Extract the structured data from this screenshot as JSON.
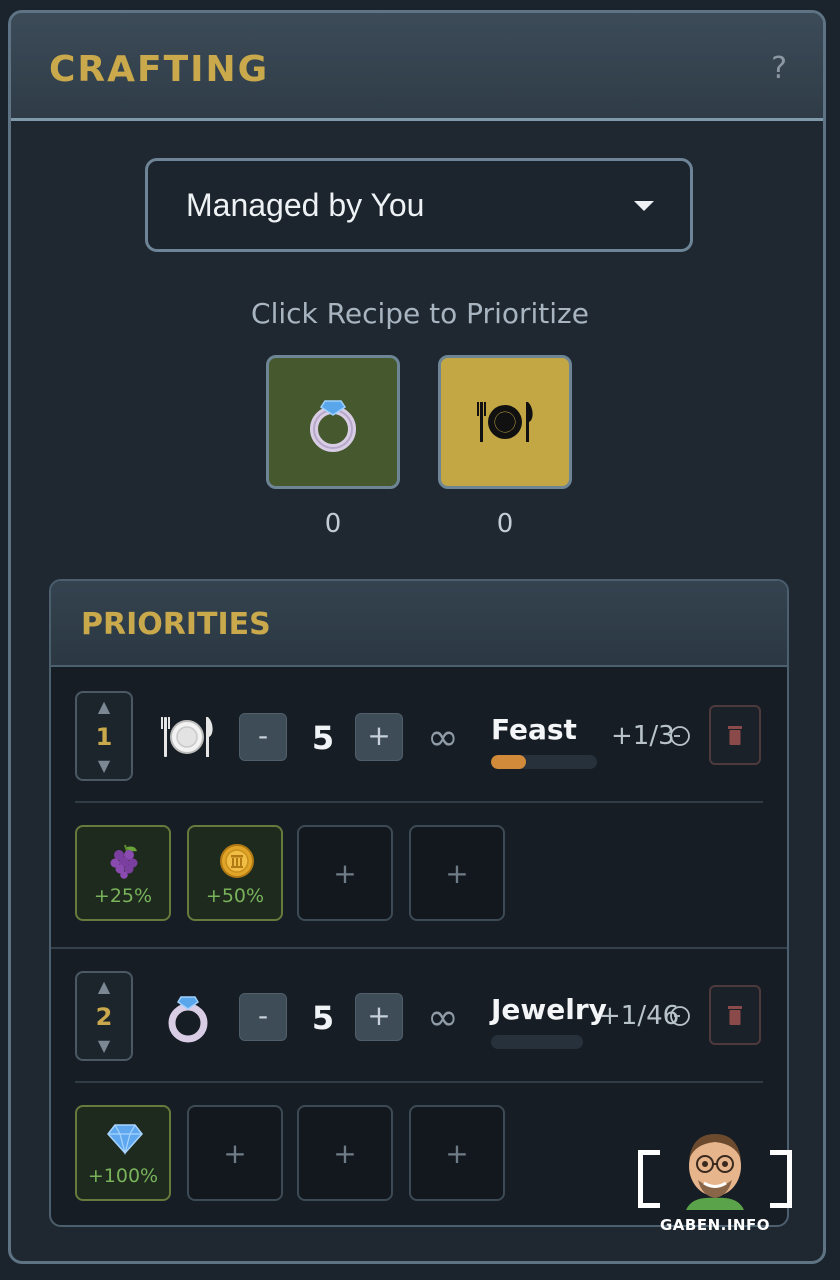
{
  "panel": {
    "title": "CRAFTING",
    "help_label": "?"
  },
  "dropdown": {
    "selected": "Managed by You"
  },
  "hint": "Click Recipe to Prioritize",
  "recipes": [
    {
      "icon": "ring-icon",
      "count": "0",
      "bg": "#46582e"
    },
    {
      "icon": "plate-cutlery-icon",
      "count": "0",
      "bg": "#c3a744"
    }
  ],
  "priorities": {
    "title": "PRIORITIES",
    "rows": [
      {
        "order": "1",
        "icon": "plate-cutlery-icon",
        "minus": "-",
        "qty": "5",
        "plus": "+",
        "limit": "∞",
        "name": "Feast",
        "progress": 0.33,
        "rate": "+1/3",
        "bonuses": [
          {
            "icon": "grapes-icon",
            "value": "+25%"
          },
          {
            "icon": "coin-icon",
            "value": "+50%"
          }
        ],
        "empty_slot": "+"
      },
      {
        "order": "2",
        "icon": "ring-icon",
        "minus": "-",
        "qty": "5",
        "plus": "+",
        "limit": "∞",
        "name": "Jewelry",
        "progress": 0,
        "rate": "+1/46",
        "bonuses": [
          {
            "icon": "gem-icon",
            "value": "+100%"
          }
        ],
        "empty_slot": "+"
      }
    ]
  },
  "watermark": {
    "text": "GABEN.INFO"
  },
  "colors": {
    "accent": "#c9a94b",
    "bonus": "#78b25a",
    "progress": "#d08a3a"
  }
}
